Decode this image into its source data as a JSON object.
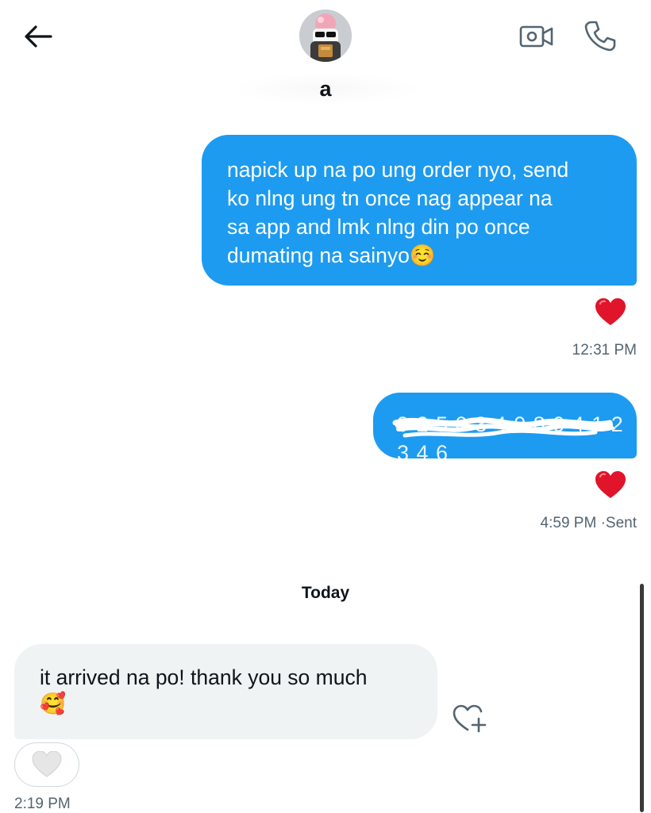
{
  "header": {
    "contact_name": "a",
    "back_icon": "arrow-left-icon",
    "video_icon": "video-camera-icon",
    "call_icon": "phone-icon"
  },
  "messages": [
    {
      "direction": "sent",
      "text": "napick up na po ung order nyo, send\nko nlng ung tn once nag appear na\nsa app and lmk nlng din po once\ndumating na sainyo",
      "emoji": "☺️",
      "reaction": "❤️",
      "timestamp": "12:31 PM"
    },
    {
      "direction": "sent",
      "text_redacted": "9 2 5 0 3 4 0 8 0 4 1 2 3 4 6",
      "reaction": "❤️",
      "timestamp": "4:59 PM",
      "status": "·Sent"
    }
  ],
  "day_separator": "Today",
  "received": {
    "text": "it arrived na po! thank you so much",
    "emoji": "🥰",
    "timestamp": "2:19 PM",
    "like_icon": "heart-outline-icon",
    "add_reaction_icon": "heart-plus-icon"
  },
  "colors": {
    "sent_bubble": "#1d9bf0",
    "received_bubble": "#eff3f4",
    "meta_text": "#536471",
    "heart": "#e0142a"
  }
}
